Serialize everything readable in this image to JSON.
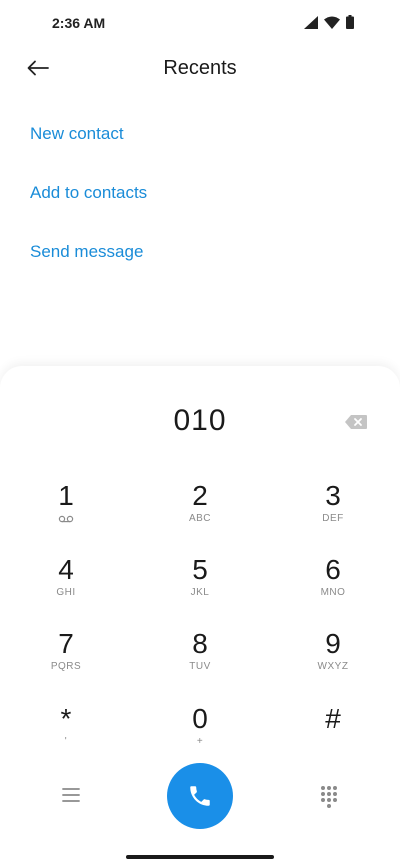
{
  "status_bar": {
    "time": "2:36 AM",
    "icons": [
      "signal-icon",
      "wifi-icon",
      "battery-icon"
    ]
  },
  "header": {
    "title": "Recents",
    "back_icon": "arrow-left-icon"
  },
  "actions": {
    "new_contact": "New contact",
    "add_to_contacts": "Add to contacts",
    "send_message": "Send message"
  },
  "dialer": {
    "number": "010",
    "backspace_icon": "backspace-icon",
    "keys": [
      {
        "digit": "1",
        "letters": "",
        "icon": "voicemail-icon"
      },
      {
        "digit": "2",
        "letters": "ABC"
      },
      {
        "digit": "3",
        "letters": "DEF"
      },
      {
        "digit": "4",
        "letters": "GHI"
      },
      {
        "digit": "5",
        "letters": "JKL"
      },
      {
        "digit": "6",
        "letters": "MNO"
      },
      {
        "digit": "7",
        "letters": "PQRS"
      },
      {
        "digit": "8",
        "letters": "TUV"
      },
      {
        "digit": "9",
        "letters": "WXYZ"
      },
      {
        "digit": "*",
        "letters": "'"
      },
      {
        "digit": "0",
        "letters": "+"
      },
      {
        "digit": "#",
        "letters": ""
      }
    ]
  },
  "bottom_bar": {
    "menu_icon": "menu-icon",
    "call_icon": "phone-icon",
    "dialpad_icon": "dialpad-icon"
  },
  "colors": {
    "accent": "#1a8cd8",
    "call_button": "#1a8fe8",
    "text": "#1a1a1a",
    "secondary_text": "#8a8a8a"
  }
}
